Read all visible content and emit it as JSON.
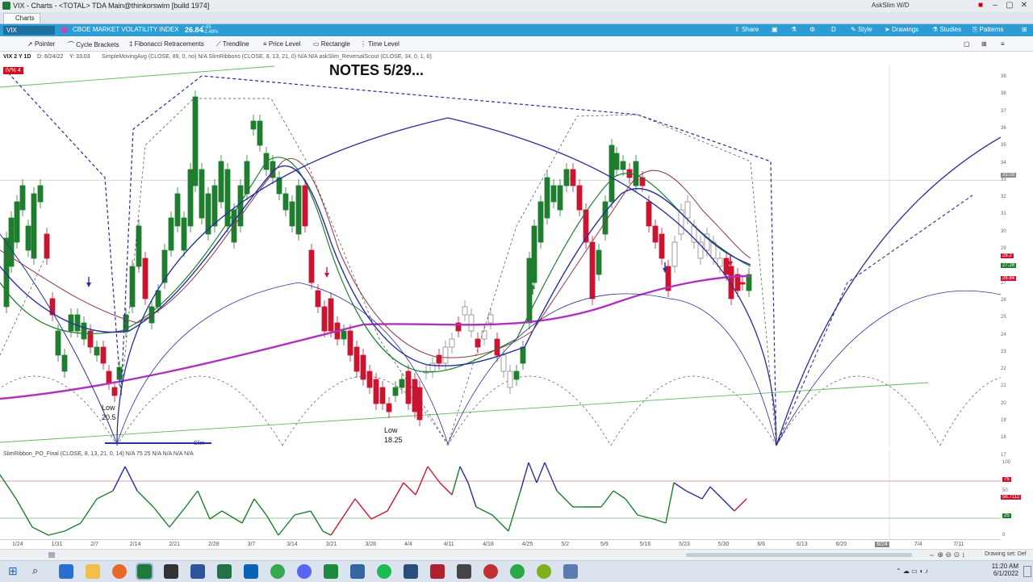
{
  "window": {
    "title": "VIX - Charts - <TOTAL> TDA Main@thinkorswim [build 1974]",
    "login": "AskSlim W/D",
    "tab": "Charts"
  },
  "symbol_bar": {
    "symbol": "VIX",
    "name": "CBOE MARKET VOLATILITY INDEX",
    "price": "26.84",
    "change_top": "+.65",
    "change_bottom": "+2.48%",
    "buttons": [
      "Share",
      "Drawings",
      "Studies",
      "Patterns",
      "Style"
    ],
    "mode_letter": "D"
  },
  "drawing_tools": [
    "Pointer",
    "Cycle Brackets",
    "Fibonacci Retracements",
    "Trendline",
    "Price Level",
    "Rectangle",
    "Time Level"
  ],
  "study_line": {
    "period": "VIX 2 Y 1D",
    "cursor": "D: 6/24/22",
    "y_value": "Y: 33.03",
    "studies": "SimpleMovingAvg (CLOSE, 89, 0, no)  N/A  SlimRibbons (CLOSE, 8, 13, 21, 0)  N/A  N/A  askSlim_ReversalScout (CLOSE, 34, 0, 1, 0)"
  },
  "badge": "IV% 4",
  "annotations": {
    "notes": "NOTES 5/29...",
    "low1_label": "Low",
    "low1_value": "20.5",
    "low2_label": "Low",
    "low2_value": "18.25",
    "cycle_tag": "Slim"
  },
  "price_scale": [
    "39",
    "38",
    "37",
    "36",
    "35",
    "34",
    "33",
    "32",
    "31",
    "30",
    "29",
    "28",
    "27",
    "26",
    "25",
    "24",
    "23",
    "22",
    "21",
    "20",
    "19",
    "18",
    "17"
  ],
  "price_markers": {
    "cursor": "33.03",
    "m1": "28.2",
    "m2": "27.28",
    "m3": "26.84"
  },
  "oscillator": {
    "label": "SlimRibbon_PO_Final (CLOSE, 8, 13, 21, 0, 14)  N/A  75  25  N/A  N/A  N/A  N/A",
    "scale": [
      "100",
      "75",
      "50",
      "25",
      "0"
    ],
    "marker_75": "75",
    "marker_val": "56.7112",
    "marker_25": "25"
  },
  "date_labels": [
    "1/24",
    "1/31",
    "2/7",
    "2/14",
    "2/21",
    "2/28",
    "3/7",
    "3/14",
    "3/21",
    "3/28",
    "4/4",
    "4/11",
    "4/18",
    "4/25",
    "5/2",
    "5/9",
    "5/16",
    "5/23",
    "5/30",
    "6/6",
    "6/13",
    "6/20",
    "6/24",
    "7/4",
    "7/11"
  ],
  "status": {
    "drawing_set": "Drawing set: Def"
  },
  "taskbar": {
    "time": "11:20 AM",
    "date": "6/1/2022"
  },
  "colors": {
    "accent": "#2a9cd6",
    "up": "#1e7d2e",
    "down": "#cc1430",
    "neutral": "#888888",
    "ma": "#b030c0",
    "cycle": "#2a2f9a"
  }
}
